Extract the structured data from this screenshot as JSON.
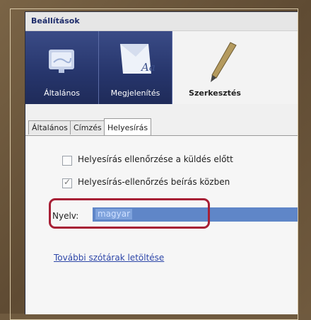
{
  "window": {
    "title": "Beállítások"
  },
  "toolbar": {
    "items": [
      {
        "label": "Általános",
        "icon": "general-settings-icon",
        "selected": true
      },
      {
        "label": "Megjelenítés",
        "icon": "display-icon",
        "selected": true
      },
      {
        "label": "Szerkesztés",
        "icon": "pen-icon",
        "selected": false
      }
    ],
    "display_icon_text": "Aa"
  },
  "tabs": [
    {
      "label": "Általános",
      "active": false
    },
    {
      "label": "Címzés",
      "active": false
    },
    {
      "label": "Helyesírás",
      "active": true
    }
  ],
  "spelling": {
    "check_before_send": {
      "label": "Helyesírás ellenőrzése a küldés előtt",
      "checked": false
    },
    "check_while_typing": {
      "label": "Helyesírás-ellenőrzés beírás közben",
      "checked": true
    },
    "language_label": "Nyelv:",
    "language_value": "magyar",
    "download_link": "További szótárak letöltése"
  },
  "colors": {
    "highlight_border": "#a71f35",
    "selected_toolbar": "#26356b",
    "link": "#2d46a8"
  }
}
